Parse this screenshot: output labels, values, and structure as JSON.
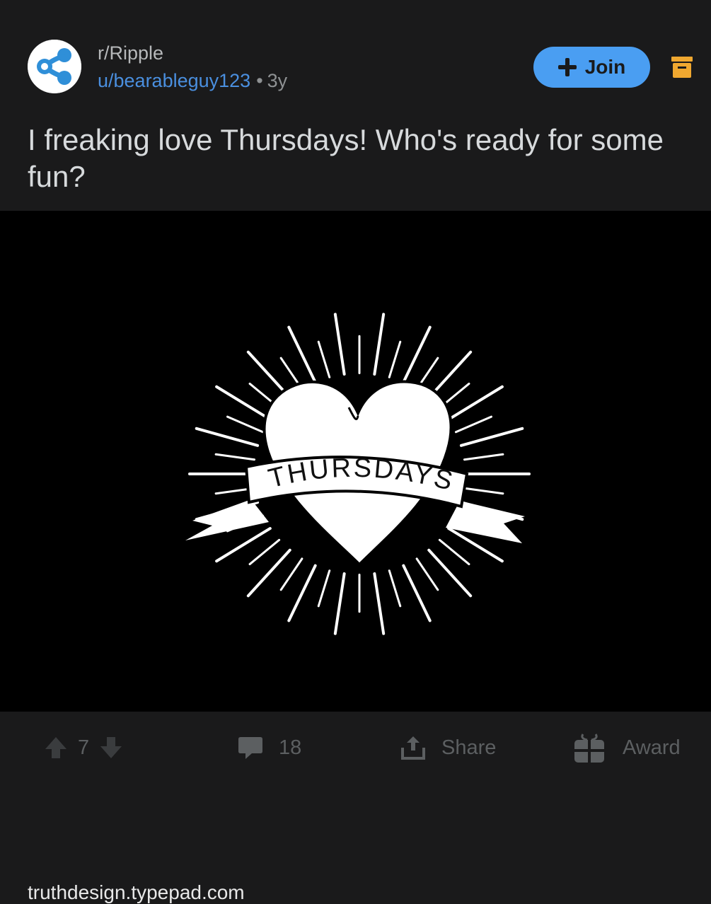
{
  "post": {
    "subreddit": "r/Ripple",
    "author": "u/bearableguy123",
    "separator": "•",
    "age": "3y",
    "join_label": "Join",
    "title": "I freaking love Thursdays! Who's ready for some fun?",
    "image_text": "THURSDAYS",
    "domain": "truthdesign.typepad.com"
  },
  "actions": {
    "votes": "7",
    "comments": "18",
    "share_label": "Share",
    "award_label": "Award"
  },
  "colors": {
    "background": "#1a1a1b",
    "accent": "#4a9ef2",
    "author_link": "#4a8fdf",
    "archive_icon": "#f0a830"
  },
  "icons": [
    "ripple-logo-icon",
    "plus-icon",
    "archive-icon",
    "upvote-icon",
    "downvote-icon",
    "comment-icon",
    "share-icon",
    "award-icon"
  ]
}
